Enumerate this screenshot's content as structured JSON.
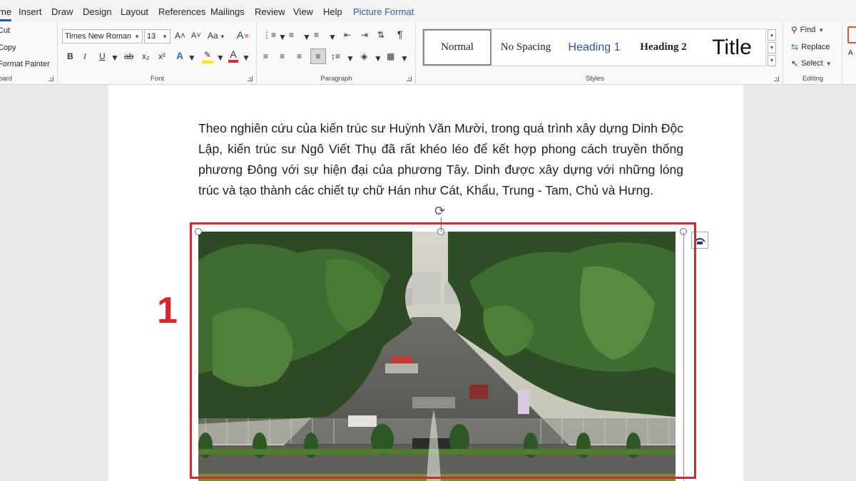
{
  "menu": {
    "tabs": [
      "me",
      "Insert",
      "Draw",
      "Design",
      "Layout",
      "References",
      "Mailings",
      "Review",
      "View",
      "Help",
      "Picture Format"
    ],
    "active_tab": "me",
    "contextual_tab": "Picture Format"
  },
  "ribbon": {
    "clipboard": {
      "cut": "Cut",
      "copy": "Copy",
      "format_painter": "Format Painter",
      "label": "oard"
    },
    "font": {
      "font_name": "Times New Roman",
      "font_size": "13",
      "grow": "A˄",
      "shrink": "A˅",
      "change_case": "Aa",
      "bold": "B",
      "italic": "I",
      "underline": "U",
      "strike": "ab",
      "subscript": "x₂",
      "superscript": "x²",
      "text_effects": "A",
      "highlight": "✎",
      "font_color": "A",
      "label": "Font"
    },
    "paragraph": {
      "pilcrow": "¶",
      "label": "Paragraph"
    },
    "styles": {
      "tiles": [
        {
          "name": "Normal"
        },
        {
          "name": "No Spacing"
        },
        {
          "name": "Heading 1"
        },
        {
          "name": "Heading 2"
        },
        {
          "name": "Title"
        }
      ],
      "label": "Styles"
    },
    "editing": {
      "find": "Find",
      "replace": "Replace",
      "select": "Select",
      "label": "Editing"
    },
    "extra": {
      "text": "A"
    }
  },
  "document": {
    "paragraph": "Theo nghiên cứu của kiến trúc sư Huỳnh Văn Mười, trong quá trình xây dựng Dinh Độc Lập, kiến trúc sư Ngô Viết Thụ đã rất khéo léo để kết hợp phong cách truyền thống phương Đông với sự hiện đại của phương Tây. Dinh được xây dựng với những lóng trúc và tạo thành các chiết tự chữ Hán như Cát, Khẩu, Trung - Tam, Chủ và Hưng."
  },
  "annotation": {
    "step_number": "1"
  },
  "colors": {
    "accent": "#185abd",
    "annotation_red": "#d7262e",
    "heading1": "#2f5496"
  },
  "icons": [
    "cut-icon",
    "copy-icon",
    "format-painter-icon",
    "find-icon",
    "replace-icon",
    "select-icon",
    "rotate-icon",
    "layout-options-icon"
  ]
}
